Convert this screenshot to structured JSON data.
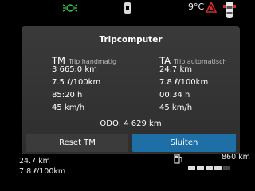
{
  "status_bar": {
    "temperature": "9°C",
    "icons": [
      "headlights-icon",
      "seatbelt-icon",
      "warning-triangle-icon",
      "car-top-icon"
    ]
  },
  "dialog": {
    "title": "Tripcomputer",
    "left": {
      "abbr": "TM",
      "label": "Trip handmatig",
      "distance": "3 665.0 km",
      "consumption": "7.5 ℓ/100km",
      "time": "85:20 h",
      "speed": "45 km/h"
    },
    "right": {
      "abbr": "TA",
      "label": "Trip automatisch",
      "distance": "24.7 km",
      "consumption": "7.8 ℓ/100km",
      "time": "00:34 h",
      "speed": "45 km/h"
    },
    "odo": "ODO:  4 629 km",
    "reset_label": "Reset TM",
    "close_label": "Sluiten"
  },
  "cluster": {
    "distance": "24.7 km",
    "consumption": "7.8 ℓ/100km",
    "fuel_level_fraction": 0.8,
    "range": "860 km"
  },
  "colors": {
    "accent": "#1d6fa6",
    "headlight_green": "#3ec24a",
    "warning_red": "#d42a2a"
  }
}
